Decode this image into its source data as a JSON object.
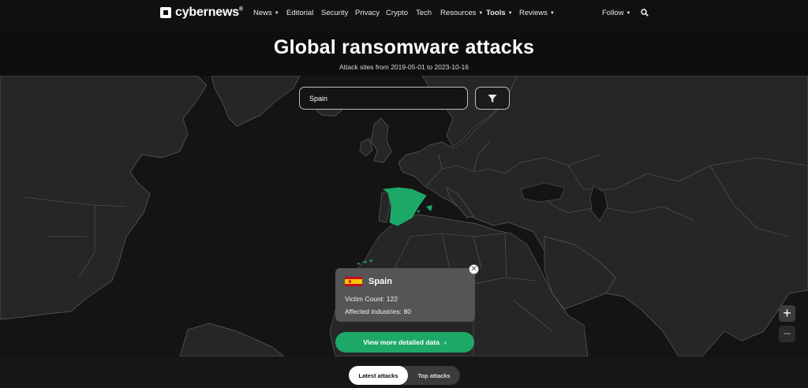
{
  "brand": {
    "name": "cybernews",
    "reg": "®"
  },
  "nav": {
    "items": [
      {
        "label": "News",
        "caret": true,
        "bold": false
      },
      {
        "label": "Editorial",
        "caret": false,
        "bold": false
      },
      {
        "label": "Security",
        "caret": false,
        "bold": false
      },
      {
        "label": "Privacy",
        "caret": false,
        "bold": false
      },
      {
        "label": "Crypto",
        "caret": false,
        "bold": false
      },
      {
        "label": "Tech",
        "caret": false,
        "bold": false
      },
      {
        "label": "Resources",
        "caret": true,
        "bold": false
      },
      {
        "label": "Tools",
        "caret": true,
        "bold": true
      },
      {
        "label": "Reviews",
        "caret": true,
        "bold": false
      }
    ],
    "follow_label": "Follow",
    "search_icon": "search-icon"
  },
  "hero": {
    "title": "Global ransomware attacks",
    "subtitle": "Attack sites from 2019-05-01 to 2023-10-16"
  },
  "search": {
    "value": "Spain",
    "filter_icon": "filter-icon"
  },
  "popup": {
    "country": "Spain",
    "victim_count": "Victim Count: 122",
    "industries": "Affected industries: 80",
    "flag_colors": [
      "#c60b1e",
      "#ffc400"
    ]
  },
  "detail_button": {
    "label": "View more detailed data",
    "icon": "chevron-right-icon"
  },
  "zoom": {
    "in": "+",
    "out": "−"
  },
  "tabs": {
    "latest": "Latest attacks",
    "top": "Top attacks"
  },
  "colors": {
    "highlight": "#1ea868",
    "land": "#262626",
    "border": "#5a5a5a",
    "sea": "#141414"
  }
}
